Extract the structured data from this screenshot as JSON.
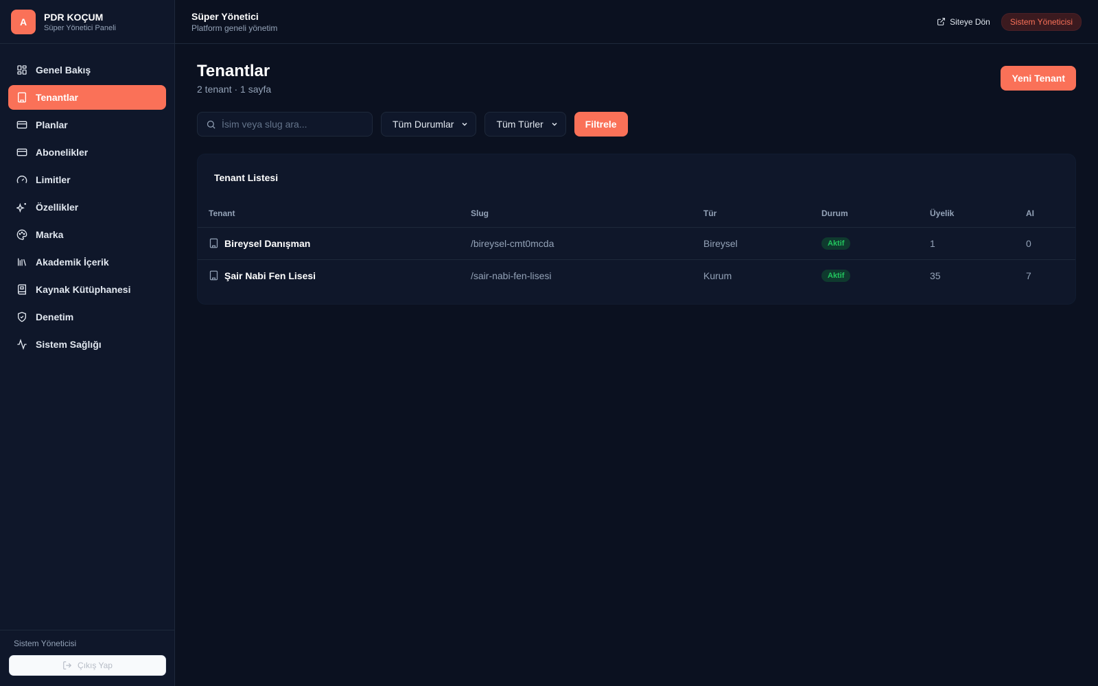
{
  "brand": {
    "logo_letter": "A",
    "title": "PDR KOÇUM",
    "subtitle": "Süper Yönetici Paneli"
  },
  "sidebar": {
    "items": [
      {
        "label": "Genel Bakış",
        "icon": "dashboard-icon",
        "active": false
      },
      {
        "label": "Tenantlar",
        "icon": "building-icon",
        "active": true
      },
      {
        "label": "Planlar",
        "icon": "credit-card-icon",
        "active": false
      },
      {
        "label": "Abonelikler",
        "icon": "credit-card-icon",
        "active": false
      },
      {
        "label": "Limitler",
        "icon": "gauge-icon",
        "active": false
      },
      {
        "label": "Özellikler",
        "icon": "sparkles-icon",
        "active": false
      },
      {
        "label": "Marka",
        "icon": "palette-icon",
        "active": false
      },
      {
        "label": "Akademik İçerik",
        "icon": "library-icon",
        "active": false
      },
      {
        "label": "Kaynak Kütüphanesi",
        "icon": "book-icon",
        "active": false
      },
      {
        "label": "Denetim",
        "icon": "shield-icon",
        "active": false
      },
      {
        "label": "Sistem Sağlığı",
        "icon": "activity-icon",
        "active": false
      }
    ],
    "footer_user": "Sistem Yöneticisi",
    "logout_label": "Çıkış Yap"
  },
  "topbar": {
    "title": "Süper Yönetici",
    "subtitle": "Platform geneli yönetim",
    "back_link": "Siteye Dön",
    "role_badge": "Sistem Yöneticisi"
  },
  "page": {
    "title": "Tenantlar",
    "subtitle": "2 tenant · 1 sayfa",
    "new_button": "Yeni Tenant"
  },
  "filters": {
    "search_placeholder": "İsim veya slug ara...",
    "status_select": "Tüm Durumlar",
    "type_select": "Tüm Türler",
    "filter_button": "Filtrele"
  },
  "table": {
    "card_title": "Tenant Listesi",
    "columns": [
      "Tenant",
      "Slug",
      "Tür",
      "Durum",
      "Üyelik",
      "AI"
    ],
    "rows": [
      {
        "name": "Bireysel Danışman",
        "slug": "/bireysel-cmt0mcda",
        "type": "Bireysel",
        "status": "Aktif",
        "members": "1",
        "ai": "0"
      },
      {
        "name": "Şair Nabi Fen Lisesi",
        "slug": "/sair-nabi-fen-lisesi",
        "type": "Kurum",
        "status": "Aktif",
        "members": "35",
        "ai": "7"
      }
    ]
  },
  "colors": {
    "accent": "#fa7158",
    "background": "#0b1120",
    "panel": "#0f172a",
    "success": "#22c55e"
  }
}
